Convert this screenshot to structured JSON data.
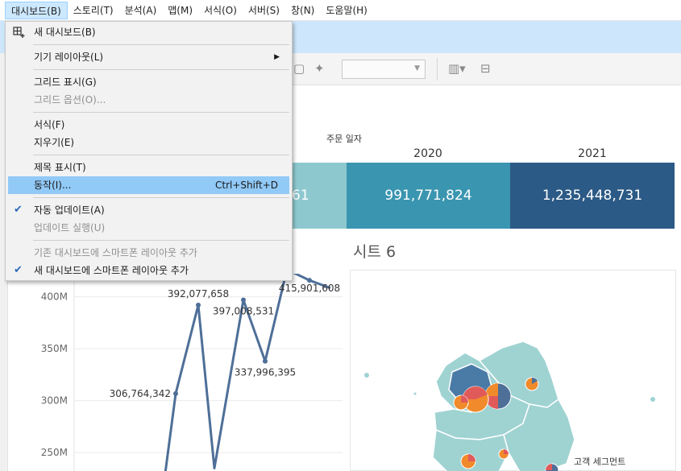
{
  "menubar": {
    "items": [
      {
        "label": "대시보드(B)",
        "active": true
      },
      {
        "label": "스토리(T)"
      },
      {
        "label": "분석(A)"
      },
      {
        "label": "맵(M)"
      },
      {
        "label": "서식(O)"
      },
      {
        "label": "서버(S)"
      },
      {
        "label": "창(N)"
      },
      {
        "label": "도움말(H)"
      }
    ]
  },
  "dropdown": {
    "new_dashboard": "새 대시보드(B)",
    "device_layout": "기기 레이아웃(L)",
    "show_grid": "그리드 표시(G)",
    "grid_options": "그리드 옵션(O)...",
    "format": "서식(F)",
    "clear": "지우기(E)",
    "show_title": "제목 표시(T)",
    "actions": "동작(I)...",
    "actions_shortcut": "Ctrl+Shift+D",
    "auto_update": "자동 업데이트(A)",
    "run_update": "업데이트 실행(U)",
    "add_phone_existing": "기존 대시보드에 스마트폰 레이아웃 추가",
    "add_phone_new": "새 대시보드에 스마트폰 레이아웃 추가"
  },
  "dashboard": {
    "order_date_label": "주문 일자",
    "years": [
      "2020",
      "2021"
    ],
    "values": [
      "61",
      "991,771,824",
      "1,235,448,731"
    ],
    "sheet6_title": "시트 6",
    "map_label": "고객 세그먼트"
  },
  "colors": {
    "cell_light": "#8ec8cf",
    "cell_mid": "#3a95b0",
    "cell_dark": "#2c5a86",
    "line": "#4e6f98",
    "map_fill": "#9fd3d2",
    "map_dark": "#4a7aa6",
    "pie_orange": "#f18a2a",
    "pie_red": "#e15a5a",
    "pie_blue": "#4e6f98"
  },
  "chart_data": {
    "type": "line",
    "y_ticks": [
      "400M",
      "350M",
      "300M",
      "250M"
    ],
    "ylim": [
      240000000,
      430000000
    ],
    "points": [
      {
        "y": 230000000,
        "label": ""
      },
      {
        "y": 306764342,
        "label": "306,764,342"
      },
      {
        "y": 392077658,
        "label": "392,077,658"
      },
      {
        "y": 235000000,
        "label": ""
      },
      {
        "y": 397008531,
        "label": "397,008,531"
      },
      {
        "y": 337996395,
        "label": "337,996,395"
      },
      {
        "y": 426336635,
        "label": "426,336,635"
      },
      {
        "y": 415901608,
        "label": "415,901,608"
      },
      {
        "y": 408500000,
        "label": ""
      }
    ]
  }
}
